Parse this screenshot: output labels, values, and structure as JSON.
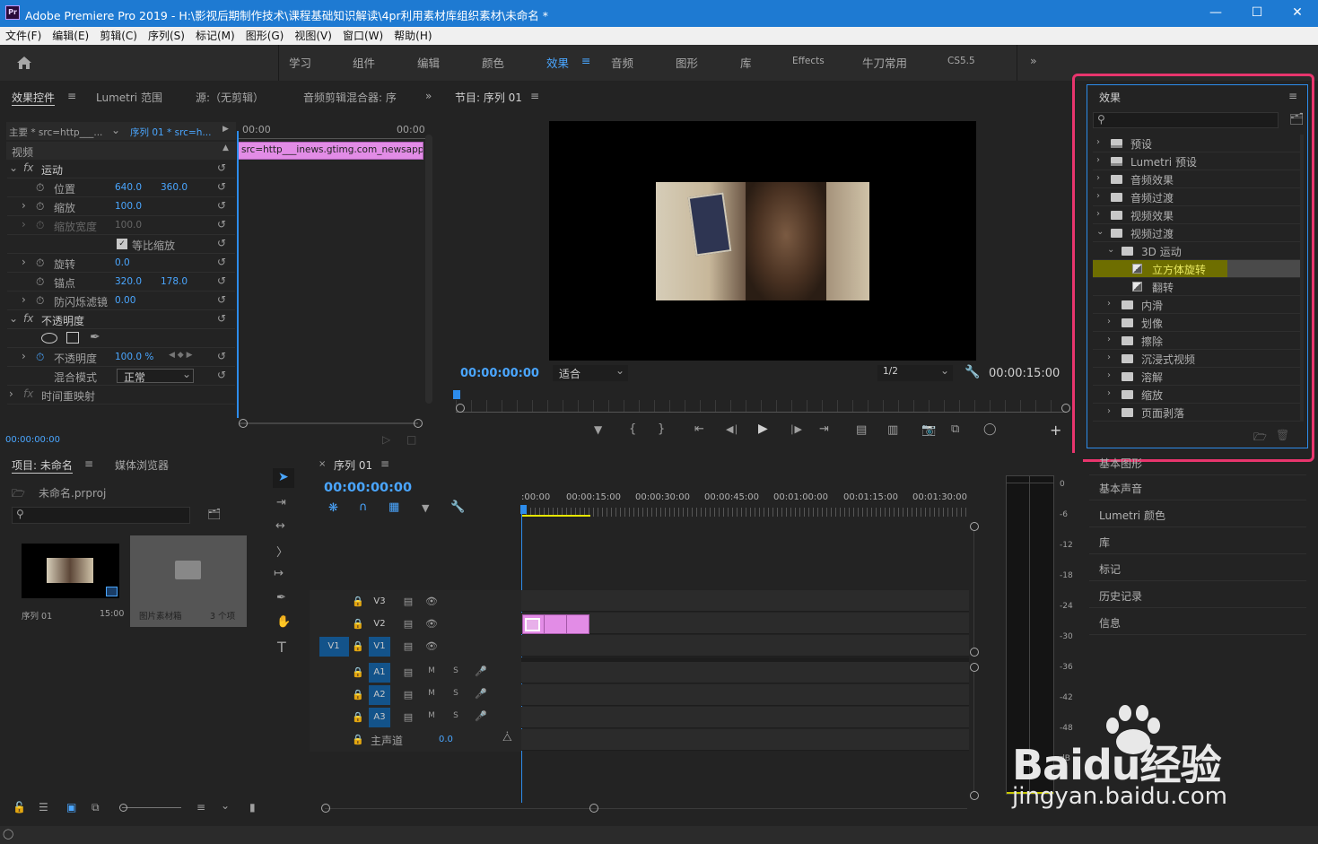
{
  "window": {
    "app_icon": "Pr",
    "title": "Adobe Premiere Pro 2019 - H:\\影视后期制作技术\\课程基础知识解读\\4pr利用素材库组织素材\\未命名 *"
  },
  "menu": [
    "文件(F)",
    "编辑(E)",
    "剪辑(C)",
    "序列(S)",
    "标记(M)",
    "图形(G)",
    "视图(V)",
    "窗口(W)",
    "帮助(H)"
  ],
  "workspaces": [
    "学习",
    "组件",
    "编辑",
    "颜色",
    "效果",
    "音频",
    "图形",
    "库",
    "Effects",
    "牛刀常用",
    "CS5.5"
  ],
  "active_workspace": "效果",
  "effect_controls": {
    "tabs": [
      "效果控件",
      "Lumetri 范围",
      "源:（无剪辑）",
      "音频剪辑混合器: 序"
    ],
    "master": "主要 * src=http___...",
    "sequence": "序列 01 * src=h...",
    "timecode_start": "00:00",
    "timecode_end": "00:00",
    "clip_label": "src=http___inews.gtimg.com_newsapp_r",
    "section_video": "视频",
    "motion": "运动",
    "position_label": "位置",
    "position_x": "640.0",
    "position_y": "360.0",
    "scale_label": "缩放",
    "scale": "100.0",
    "scale_width_label": "缩放宽度",
    "scale_width": "100.0",
    "uniform_scale": "等比缩放",
    "rotation_label": "旋转",
    "rotation": "0.0",
    "anchor_label": "锚点",
    "anchor_x": "320.0",
    "anchor_y": "178.0",
    "antiflicker_label": "防闪烁滤镜",
    "antiflicker": "0.00",
    "opacity_section": "不透明度",
    "opacity_label": "不透明度",
    "opacity": "100.0 %",
    "blend_label": "混合模式",
    "blend": "正常",
    "time_remap": "时间重映射",
    "footer_time": "00:00:00:00"
  },
  "program": {
    "title": "节目: 序列 01",
    "timecode": "00:00:00:00",
    "fit": "适合",
    "resolution": "1/2",
    "duration": "00:00:15:00"
  },
  "effects_panel": {
    "title": "效果",
    "items": [
      {
        "label": "预设",
        "depth": 0,
        "icon": "preset-folder-icon",
        "expanded": false
      },
      {
        "label": "Lumetri 预设",
        "depth": 0,
        "icon": "preset-folder-icon",
        "expanded": false
      },
      {
        "label": "音频效果",
        "depth": 0,
        "icon": "folder-icon",
        "expanded": false
      },
      {
        "label": "音频过渡",
        "depth": 0,
        "icon": "folder-icon",
        "expanded": false
      },
      {
        "label": "视频效果",
        "depth": 0,
        "icon": "folder-icon",
        "expanded": false
      },
      {
        "label": "视频过渡",
        "depth": 0,
        "icon": "folder-icon",
        "expanded": true
      },
      {
        "label": "3D 运动",
        "depth": 1,
        "icon": "folder-icon",
        "expanded": true
      },
      {
        "label": "立方体旋转",
        "depth": 2,
        "icon": "transition-icon",
        "selected": true
      },
      {
        "label": "翻转",
        "depth": 2,
        "icon": "transition-icon"
      },
      {
        "label": "内滑",
        "depth": 1,
        "icon": "folder-icon",
        "expanded": false
      },
      {
        "label": "划像",
        "depth": 1,
        "icon": "folder-icon",
        "expanded": false
      },
      {
        "label": "擦除",
        "depth": 1,
        "icon": "folder-icon",
        "expanded": false
      },
      {
        "label": "沉浸式视频",
        "depth": 1,
        "icon": "folder-icon",
        "expanded": false
      },
      {
        "label": "溶解",
        "depth": 1,
        "icon": "folder-icon",
        "expanded": false
      },
      {
        "label": "缩放",
        "depth": 1,
        "icon": "folder-icon",
        "expanded": false
      },
      {
        "label": "页面剥落",
        "depth": 1,
        "icon": "folder-icon",
        "expanded": false
      }
    ]
  },
  "side_panels": [
    "基本图形",
    "基本声音",
    "Lumetri 颜色",
    "库",
    "标记",
    "历史记录",
    "信息"
  ],
  "project": {
    "tab": "项目: 未命名",
    "tab2": "媒体浏览器",
    "file": "未命名.prproj",
    "items": [
      {
        "name": "序列 01",
        "meta": "15:00"
      },
      {
        "name": "图片素材箱",
        "meta": "3 个项"
      }
    ]
  },
  "timeline": {
    "tab": "序列 01",
    "timecode": "00:00:00:00",
    "ruler": [
      ":00:00",
      "00:00:15:00",
      "00:00:30:00",
      "00:00:45:00",
      "00:01:00:00",
      "00:01:15:00",
      "00:01:30:00"
    ],
    "video_tracks": [
      "V3",
      "V2",
      "V1"
    ],
    "audio_tracks": [
      "A1",
      "A2",
      "A3"
    ],
    "source_patch": "V1",
    "master_label": "主声道",
    "master_value": "0.0",
    "mute": "M",
    "solo": "S"
  },
  "meter": {
    "scale": [
      "0",
      "-6",
      "-12",
      "-18",
      "-24",
      "-30",
      "-36",
      "-42",
      "-48",
      "dB"
    ]
  },
  "watermark": {
    "brand": "Baidu经验",
    "url": "jingyan.baidu.com"
  },
  "colors": {
    "accent": "#2d8ceb",
    "highlight": "#e8356d",
    "clip": "#e28ce6",
    "timecode": "#4aa6ff"
  }
}
